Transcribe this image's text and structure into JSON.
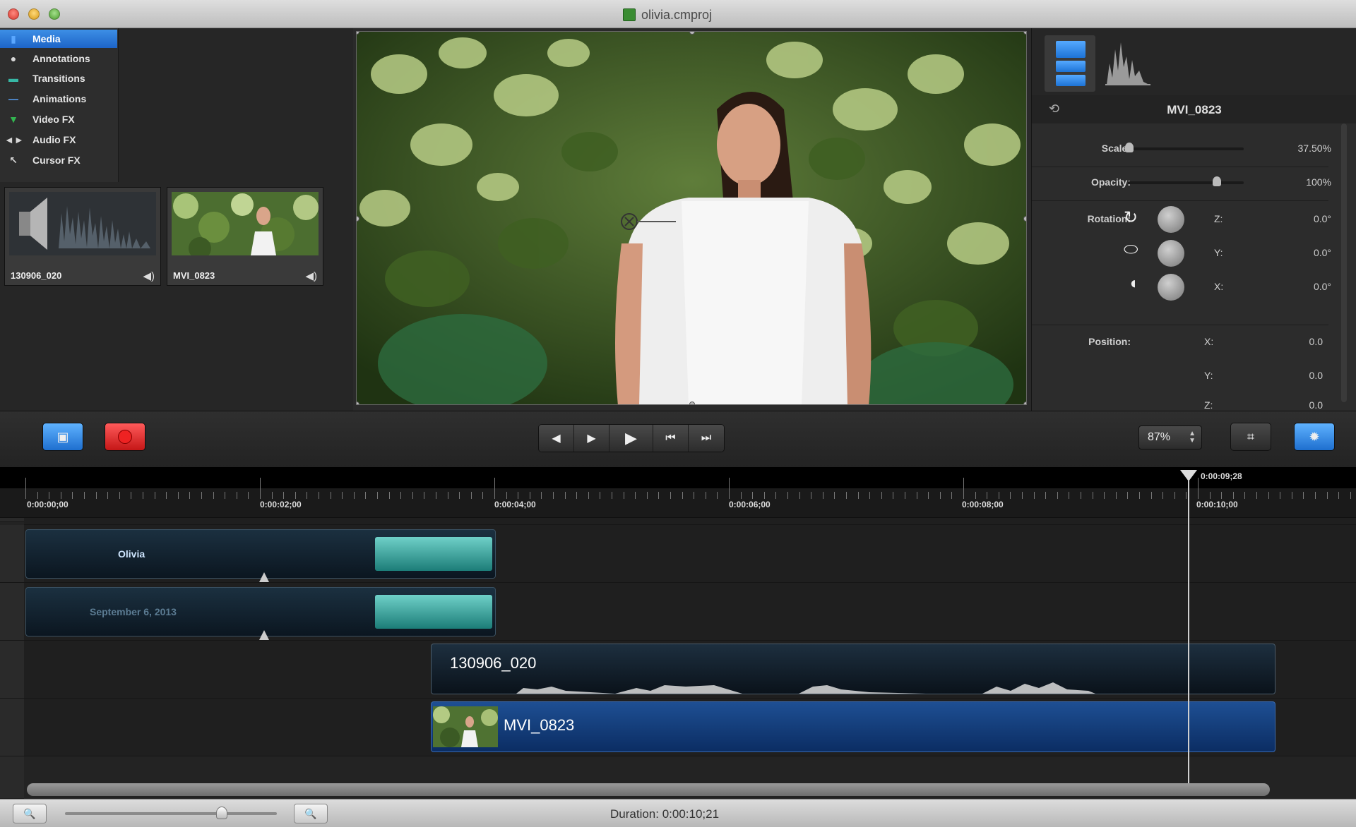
{
  "window": {
    "title": "olivia.cmproj"
  },
  "library": {
    "categories": [
      {
        "label": "Media",
        "icon": "media-icon",
        "active": true
      },
      {
        "label": "Annotations",
        "icon": "annotations-icon",
        "active": false
      },
      {
        "label": "Transitions",
        "icon": "transitions-icon",
        "active": false
      },
      {
        "label": "Animations",
        "icon": "animations-icon",
        "active": false
      },
      {
        "label": "Video FX",
        "icon": "video-fx-icon",
        "active": false
      },
      {
        "label": "Audio FX",
        "icon": "audio-fx-icon",
        "active": false
      },
      {
        "label": "Cursor FX",
        "icon": "cursor-fx-icon",
        "active": false
      }
    ],
    "media": [
      {
        "label": "130906_020",
        "type": "audio"
      },
      {
        "label": "MVI_0823",
        "type": "video"
      }
    ]
  },
  "properties": {
    "clip_name": "MVI_0823",
    "scale_label": "Scale:",
    "scale_value": "37.50%",
    "opacity_label": "Opacity:",
    "opacity_value": "100%",
    "rotation_label": "Rotation:",
    "rotation": {
      "z_label": "Z:",
      "z": "0.0°",
      "y_label": "Y:",
      "y": "0.0°",
      "x_label": "X:",
      "x": "0.0°"
    },
    "position_label": "Position:",
    "position": {
      "x_label": "X:",
      "x": "0.0",
      "y_label": "Y:",
      "y": "0.0",
      "z_label": "Z:",
      "z": "0.0"
    }
  },
  "transport": {
    "zoom": "87%",
    "buttons": [
      "rewind-icon",
      "step-forward-icon",
      "play-icon",
      "previous-marker-icon",
      "next-marker-icon"
    ]
  },
  "timeline": {
    "ticks": [
      "0:00:00;00",
      "0:00:02;00",
      "0:00:04;00",
      "0:00:06;00",
      "0:00:08;00",
      "0:00:10;00"
    ],
    "playhead_time": "0:00:09;28",
    "tracks": {
      "callout_1": "Olivia",
      "callout_2": "September 6, 2013",
      "audio_clip": "130906_020",
      "video_clip": "MVI_0823"
    }
  },
  "status": {
    "duration": "Duration: 0:00:10;21"
  },
  "colors": {
    "accent": "#1d64c7",
    "record": "#e22222",
    "video_clip": "#1e4f93",
    "callout_tail": "#1c7d78"
  }
}
